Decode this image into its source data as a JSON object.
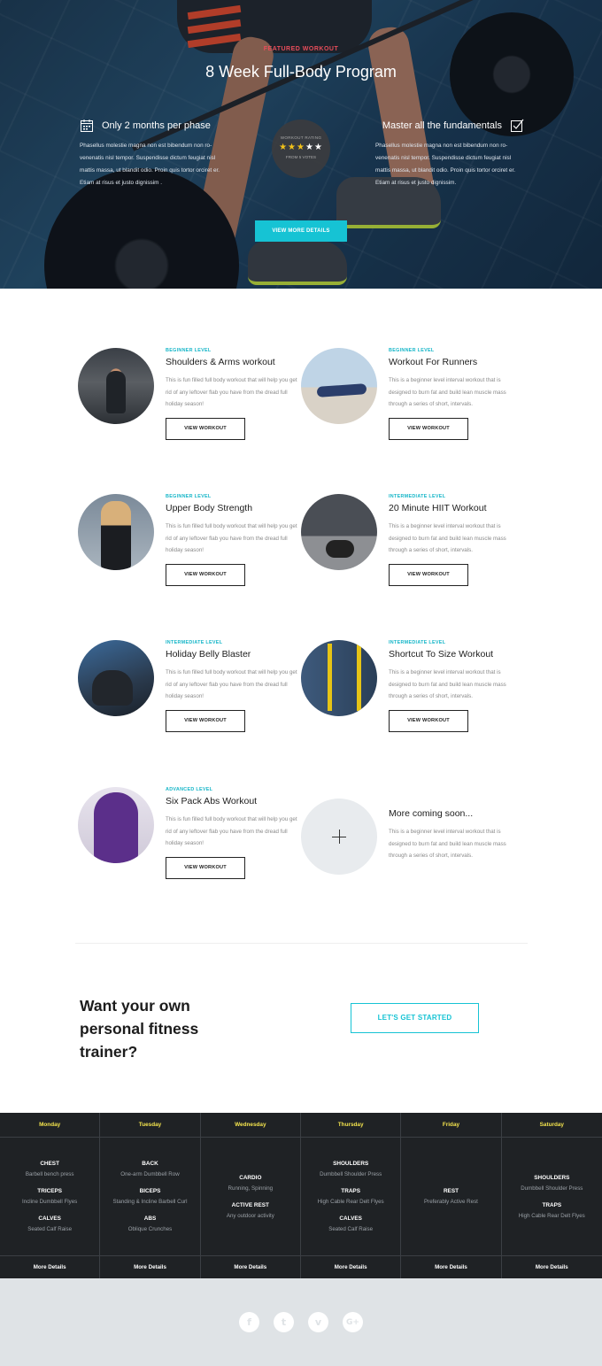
{
  "hero": {
    "eyebrow": "FEATURED WORKOUT",
    "title": "8 Week Full-Body Program",
    "left_feature": {
      "title": "Only 2 months per phase",
      "icon": "calendar-icon",
      "body": "Phasellus molestie magna non est bibendum non ro-venenatis nisl tempor. Suspendisse dictum feugiat nisl mattis massa, ut blandit odio. Proin quis tortor orciret er. Etiam at risus et justo dignissim ."
    },
    "right_feature": {
      "title": "Master all the fundamentals",
      "icon": "checkbox-icon",
      "body": "Phasellus molestie magna non est bibendum non ro-venenatis nisl tempor. Suspendisse dictum feugiat nisl mattis massa, ut blandit odio. Proin quis tortor orciret er. Etiam at risus et justo dignissim."
    },
    "rating": {
      "label": "WORKOUT RATING",
      "stars_filled": 3,
      "stars_total": 5,
      "votes": "FROM 5 VOTES"
    },
    "button": "VIEW MORE DETAILS"
  },
  "workouts": [
    {
      "level": "BEGINNER LEVEL",
      "title": "Shoulders & Arms workout",
      "desc": "This is fun filled full body workout that will help you get rid of any leftover flab you have from the dread full holiday season!",
      "button": "VIEW WORKOUT"
    },
    {
      "level": "BEGINNER LEVEL",
      "title": "Workout For Runners",
      "desc": "This is a beginner level interval workout that is designed to burn fat and build lean muscle mass through a series of short, intervals.",
      "button": "VIEW WORKOUT"
    },
    {
      "level": "BEGINNER LEVEL",
      "title": "Upper Body Strength",
      "desc": "This is fun filled full body workout that will help you get rid of any leftover flab you have from the dread full holiday season!",
      "button": "VIEW WORKOUT"
    },
    {
      "level": "INTERMEDIATE LEVEL",
      "title": "20 Minute HIIT Workout",
      "desc": "This is a beginner level interval workout that is designed to burn fat and build lean muscle mass through a series of short, intervals.",
      "button": "VIEW WORKOUT"
    },
    {
      "level": "INTERMEDIATE LEVEL",
      "title": "Holiday Belly Blaster",
      "desc": "This is fun filled full body workout that will help you get rid of any leftover flab you have from the dread full holiday season!",
      "button": "VIEW WORKOUT"
    },
    {
      "level": "INTERMEDIATE LEVEL",
      "title": "Shortcut To Size Workout",
      "desc": "This is a beginner level interval workout that is designed to burn fat and build lean muscle mass through a series of short, intervals.",
      "button": "VIEW WORKOUT"
    },
    {
      "level": "ADVANCED LEVEL",
      "title": "Six Pack Abs Workout",
      "desc": "This is fun filled full body workout that will help you get rid of any leftover flab you have from the dread full holiday season!",
      "button": "VIEW WORKOUT"
    }
  ],
  "coming_soon": {
    "title": "More coming soon...",
    "desc": "This is a beginner level interval workout that is designed to burn fat and build lean muscle mass through a series of short, intervals.",
    "icon": "plus-icon"
  },
  "cta": {
    "text": "Want your own personal fitness trainer?",
    "button": "LET'S GET STARTED"
  },
  "schedule": [
    {
      "day": "Monday",
      "exercises": [
        {
          "name": "CHEST",
          "detail": "Barbell bench press"
        },
        {
          "name": "TRICEPS",
          "detail": "Incline Dumbbell Flyes"
        },
        {
          "name": "CALVES",
          "detail": "Seated Calf Raise"
        }
      ],
      "more": "More Details"
    },
    {
      "day": "Tuesday",
      "exercises": [
        {
          "name": "BACK",
          "detail": "One-arm Dumbbell Row"
        },
        {
          "name": "BICEPS",
          "detail": "Standing & Incline Barbell Curl"
        },
        {
          "name": "ABS",
          "detail": "Oblique Crunches"
        }
      ],
      "more": "More Details"
    },
    {
      "day": "Wednesday",
      "exercises": [
        {
          "name": "CARDIO",
          "detail": "Running, Spinning"
        },
        {
          "name": "ACTIVE REST",
          "detail": "Any outdoor activity"
        }
      ],
      "more": "More Details"
    },
    {
      "day": "Thursday",
      "exercises": [
        {
          "name": "SHOULDERS",
          "detail": "Dumbbell Shoulder Press"
        },
        {
          "name": "TRAPS",
          "detail": "High Cable Rear Delt Flyes"
        },
        {
          "name": "CALVES",
          "detail": "Seated Calf Raise"
        }
      ],
      "more": "More Details"
    },
    {
      "day": "Friday",
      "exercises": [
        {
          "name": "REST",
          "detail": "Preferably Active Rest"
        }
      ],
      "more": "More Details"
    },
    {
      "day": "Saturday",
      "exercises": [
        {
          "name": "SHOULDERS",
          "detail": "Dumbbell Shoulder Press"
        },
        {
          "name": "TRAPS",
          "detail": "High Cable Rear Delt Flyes"
        }
      ],
      "more": "More Details"
    }
  ],
  "social": [
    {
      "icon": "facebook-icon",
      "glyph": "f"
    },
    {
      "icon": "twitter-icon",
      "glyph": "t"
    },
    {
      "icon": "vimeo-icon",
      "glyph": "v"
    },
    {
      "icon": "google-plus-icon",
      "glyph": "G+"
    }
  ],
  "colors": {
    "accent": "#16c3d4",
    "eyebrow": "#e84d5a",
    "star": "#f2c21a",
    "schedule_bg": "#1f2225",
    "day_name": "#f3e34d",
    "footer_bg": "#dfe3e6"
  }
}
